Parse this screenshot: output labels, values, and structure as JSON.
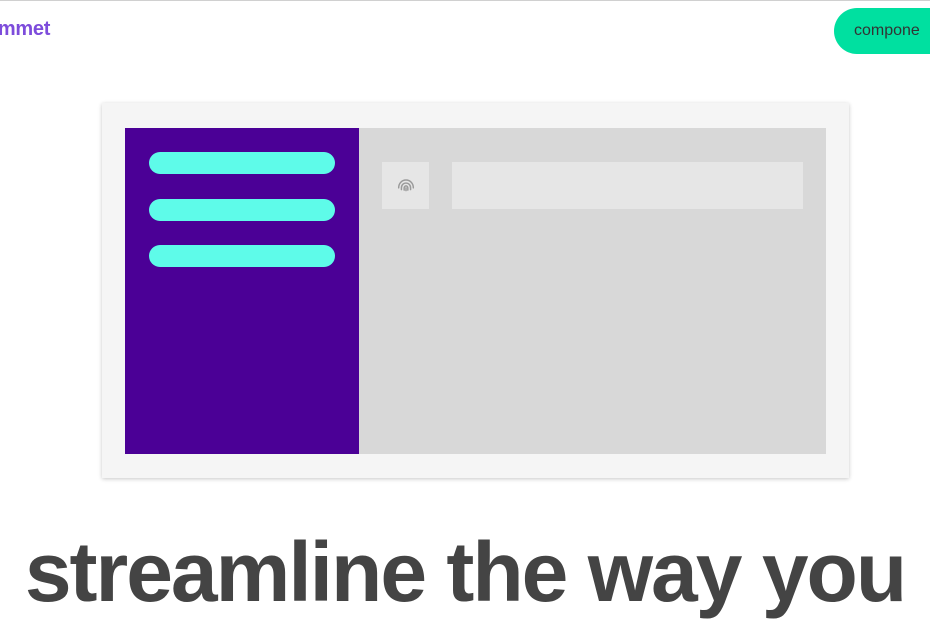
{
  "header": {
    "brand_text": "ommet",
    "components_button_label": "compone"
  },
  "preview": {
    "sidebar_menu_items": 3,
    "icon": "fingerprint-icon"
  },
  "hero": {
    "headline": "streamline the way you"
  },
  "colors": {
    "brand": "#7d4cdb",
    "button": "#00e0a0",
    "sidebar": "#4b0096",
    "pill": "#5efbe9",
    "main_area": "#d8d8d8",
    "headline": "#444444"
  }
}
